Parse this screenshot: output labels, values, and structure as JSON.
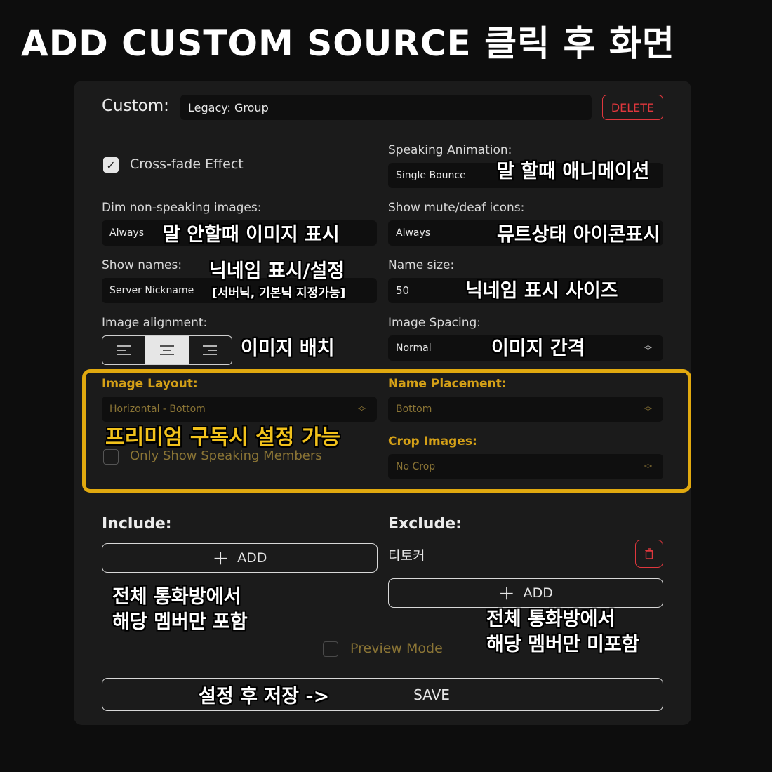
{
  "headline": "ADD CUSTOM SOURCE 클릭 후 화면",
  "colors": {
    "accent_gold": "#e1a90f",
    "danger_red": "#e0373d",
    "panel_bg": "#1b1b1b"
  },
  "custom": {
    "label": "Custom:",
    "name_value": "Legacy: Group",
    "delete_label": "DELETE"
  },
  "crossfade": {
    "label": "Cross-fade Effect",
    "checked": true
  },
  "speaking_animation": {
    "label": "Speaking Animation:",
    "value": "Single Bounce"
  },
  "dim_images": {
    "label": "Dim non-speaking images:",
    "value": "Always"
  },
  "mute_icons": {
    "label": "Show mute/deaf icons:",
    "value": "Always"
  },
  "show_names": {
    "label": "Show names:",
    "value": "Server Nickname"
  },
  "name_size": {
    "label": "Name size:",
    "value": "50"
  },
  "image_alignment": {
    "label": "Image alignment:",
    "options": [
      "align-left-icon",
      "align-center-icon",
      "align-right-icon"
    ],
    "selected": "align-center-icon"
  },
  "image_spacing": {
    "label": "Image Spacing:",
    "value": "Normal"
  },
  "image_layout": {
    "label": "Image Layout:",
    "value": "Horizontal - Bottom"
  },
  "name_placement": {
    "label": "Name Placement:",
    "value": "Bottom"
  },
  "crop_images": {
    "label": "Crop Images:",
    "value": "No Crop"
  },
  "only_speaking": {
    "label": "Only Show Speaking Members",
    "checked": false
  },
  "include": {
    "label": "Include:",
    "add_label": "ADD"
  },
  "exclude": {
    "label": "Exclude:",
    "member": "티토커",
    "add_label": "ADD"
  },
  "preview_mode": {
    "label": "Preview Mode",
    "checked": false
  },
  "save_label": "SAVE",
  "annotations": {
    "speaking_animation": "말 할때 애니메이션",
    "dim_images": "말 안할때 이미지 표시",
    "mute_icons": "뮤트상태 아이콘표시",
    "show_names": "닉네임 표시/설정",
    "show_names_sub": "[서버닉, 기본닉 지정가능]",
    "name_size": "닉네임 표시 사이즈",
    "image_alignment": "이미지 배치",
    "image_spacing": "이미지 간격",
    "premium": "프리미엄 구독시 설정 가능",
    "include_line1": "전체 통화방에서",
    "include_line2": "해당 멤버만 포함",
    "exclude_line1": "전체 통화방에서",
    "exclude_line2": "해당 멤버만 미포함",
    "save": "설정 후 저장 ->"
  }
}
